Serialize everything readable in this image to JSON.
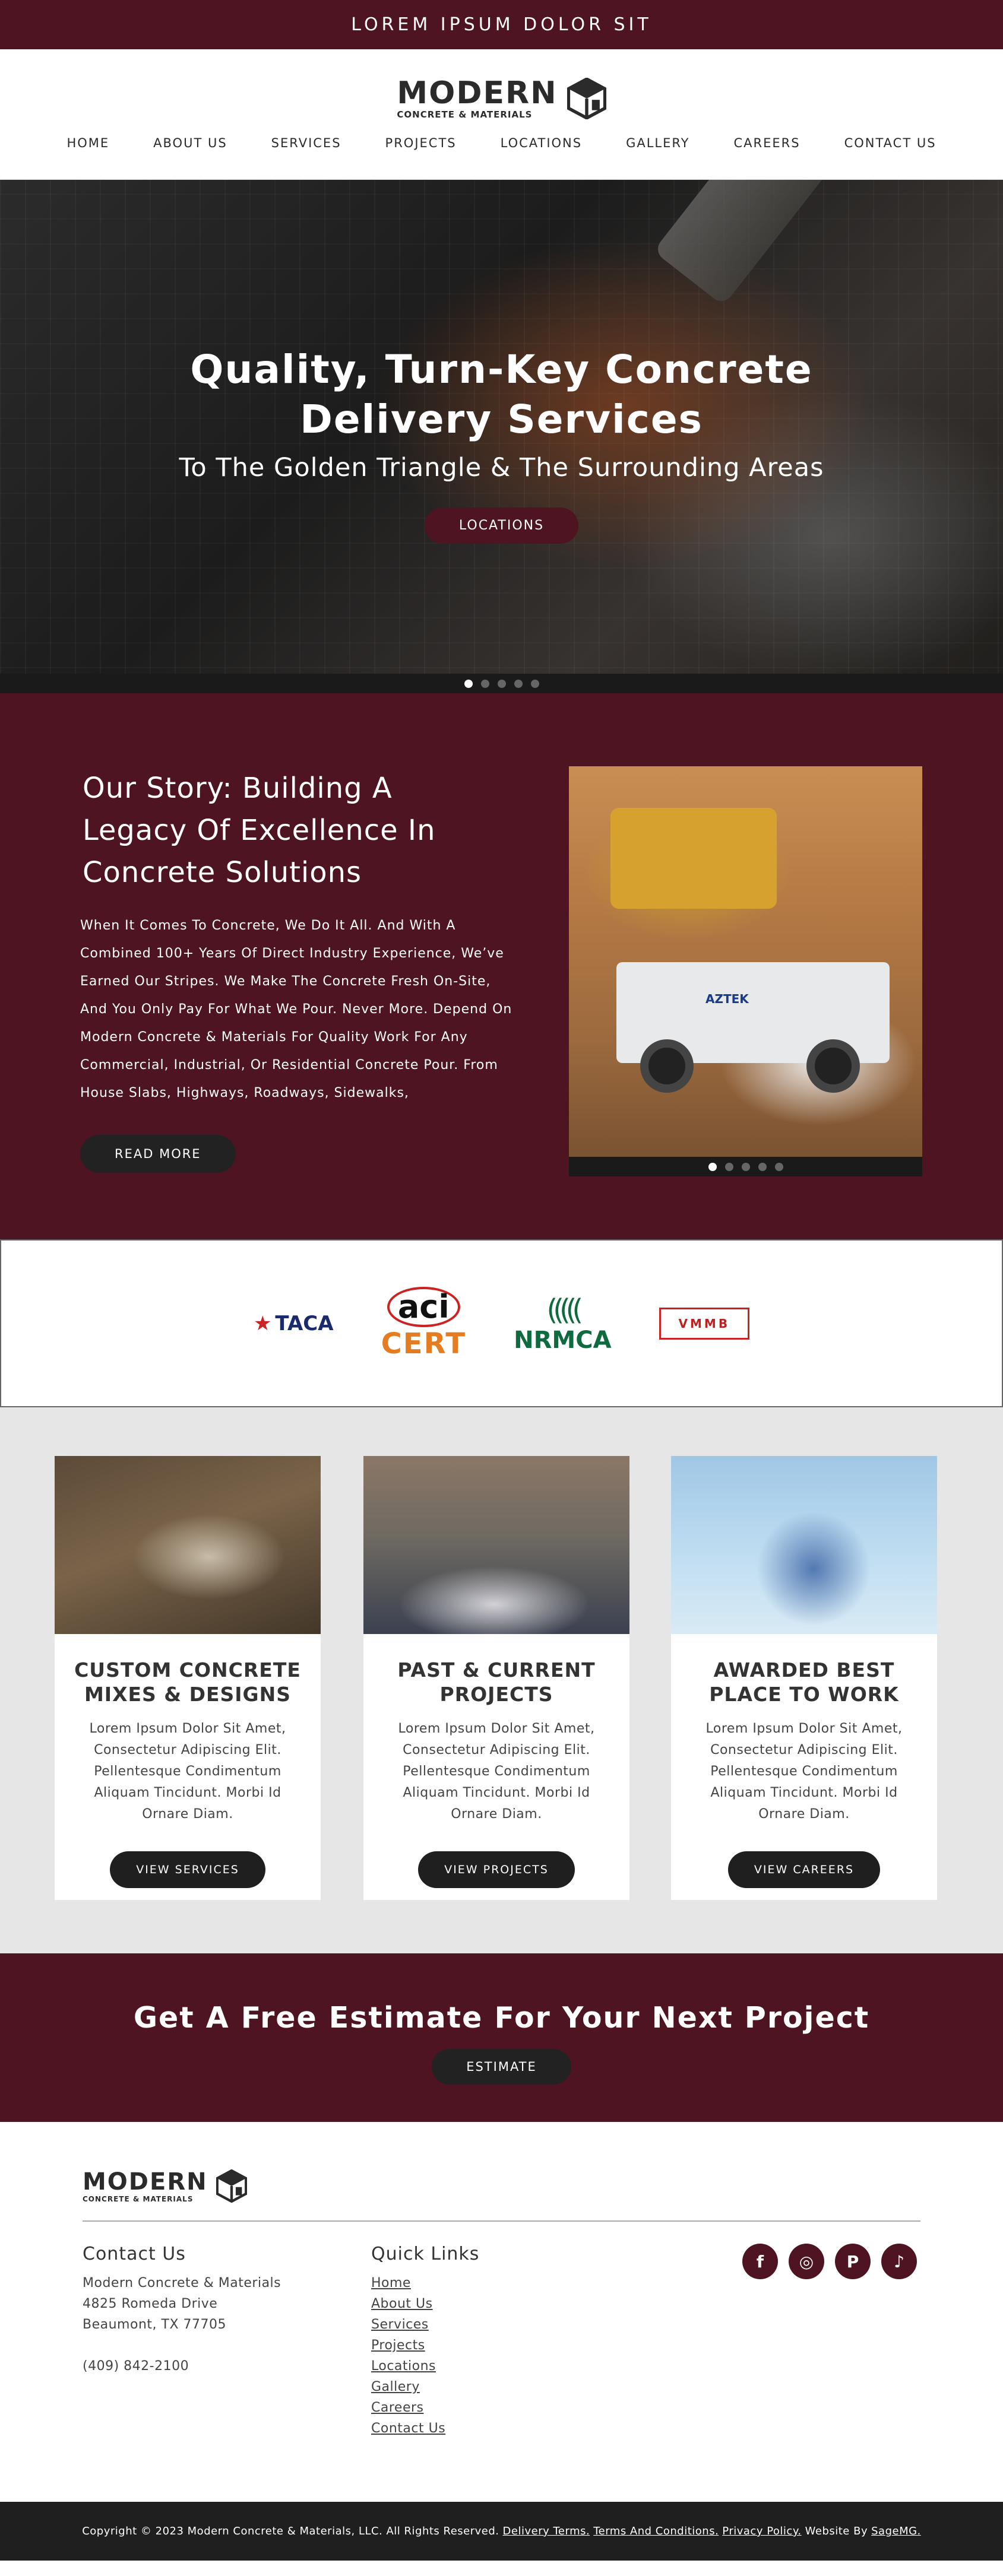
{
  "topbar": {
    "text": "LOREM IPSUM DOLOR SIT"
  },
  "brand": {
    "name": "MODERN",
    "tagline": "CONCRETE & MATERIALS",
    "icon": "cube-logo-icon"
  },
  "nav": [
    "HOME",
    "ABOUT US",
    "SERVICES",
    "PROJECTS",
    "LOCATIONS",
    "GALLERY",
    "CAREERS",
    "CONTACT US"
  ],
  "hero": {
    "title_line1": "Quality, Turn-Key Concrete",
    "title_line2": "Delivery Services",
    "subtitle": "To The Golden Triangle & The Surrounding Areas",
    "button": "LOCATIONS",
    "slide_count": 5,
    "active_slide": 1
  },
  "story": {
    "title": "Our Story: Building A Legacy Of Excellence In Concrete Solutions",
    "body": "When It Comes To Concrete, We Do It All. And With A Combined 100+ Years Of Direct Industry Experience, We’ve Earned Our Stripes. We Make The Concrete Fresh On-Site, And You Only Pay For What We Pour. Never More. Depend On Modern Concrete & Materials For Quality Work For Any Commercial, Industrial, Or Residential Concrete Pour. From House Slabs, Highways, Roadways, Sidewalks,",
    "button": "READ MORE",
    "truck_label": "AZTEK",
    "slide_count": 5,
    "active_slide": 1
  },
  "certifications": {
    "taca": "TACA",
    "aci_top": "aci",
    "aci_bottom": "CERT",
    "nrmca": "NRMCA",
    "vmmb": "VMMB"
  },
  "cards": [
    {
      "title_line1": "CUSTOM CONCRETE",
      "title_line2": "MIXES & DESIGNS",
      "text": "Lorem Ipsum Dolor Sit Amet, Consectetur Adipiscing Elit. Pellentesque Condimentum Aliquam Tincidunt. Morbi Id Ornare Diam.",
      "button": "VIEW SERVICES"
    },
    {
      "title_line1": "PAST & CURRENT",
      "title_line2": "PROJECTS",
      "text": "Lorem Ipsum Dolor Sit Amet, Consectetur Adipiscing Elit. Pellentesque Condimentum Aliquam Tincidunt. Morbi Id Ornare Diam.",
      "button": "VIEW PROJECTS"
    },
    {
      "title_line1": "AWARDED BEST",
      "title_line2": "PLACE TO WORK",
      "text": "Lorem Ipsum Dolor Sit Amet, Consectetur Adipiscing Elit. Pellentesque Condimentum Aliquam Tincidunt. Morbi Id Ornare Diam.",
      "button": "VIEW CAREERS"
    }
  ],
  "estimate": {
    "title": "Get A Free Estimate For Your Next Project",
    "button": "ESTIMATE"
  },
  "footer": {
    "contact_heading": "Contact Us",
    "company": "Modern Concrete & Materials",
    "address1": "4825 Romeda Drive",
    "address2": "Beaumont, TX 77705",
    "phone": "(409) 842-2100",
    "links_heading": "Quick Links",
    "links": [
      "Home",
      "About Us",
      "Services",
      "Projects",
      "Locations",
      "Gallery",
      "Careers",
      "Contact Us"
    ],
    "socials": [
      {
        "name": "facebook-icon",
        "glyph": "f"
      },
      {
        "name": "instagram-icon",
        "glyph": "◎"
      },
      {
        "name": "pinterest-icon",
        "glyph": "P"
      },
      {
        "name": "tiktok-icon",
        "glyph": "♪"
      }
    ]
  },
  "copyright": {
    "text": "Copyright © 2023 Modern Concrete & Materials, LLC. All Rights Reserved.",
    "delivery_terms": "Delivery Terms.",
    "terms": "Terms And Conditions.",
    "privacy": "Privacy Policy.",
    "website_by": "Website By",
    "agency": "SageMG."
  },
  "colors": {
    "brand": "#4e1421",
    "dark": "#1f1f1f",
    "light_bg": "#e6e6e6"
  }
}
